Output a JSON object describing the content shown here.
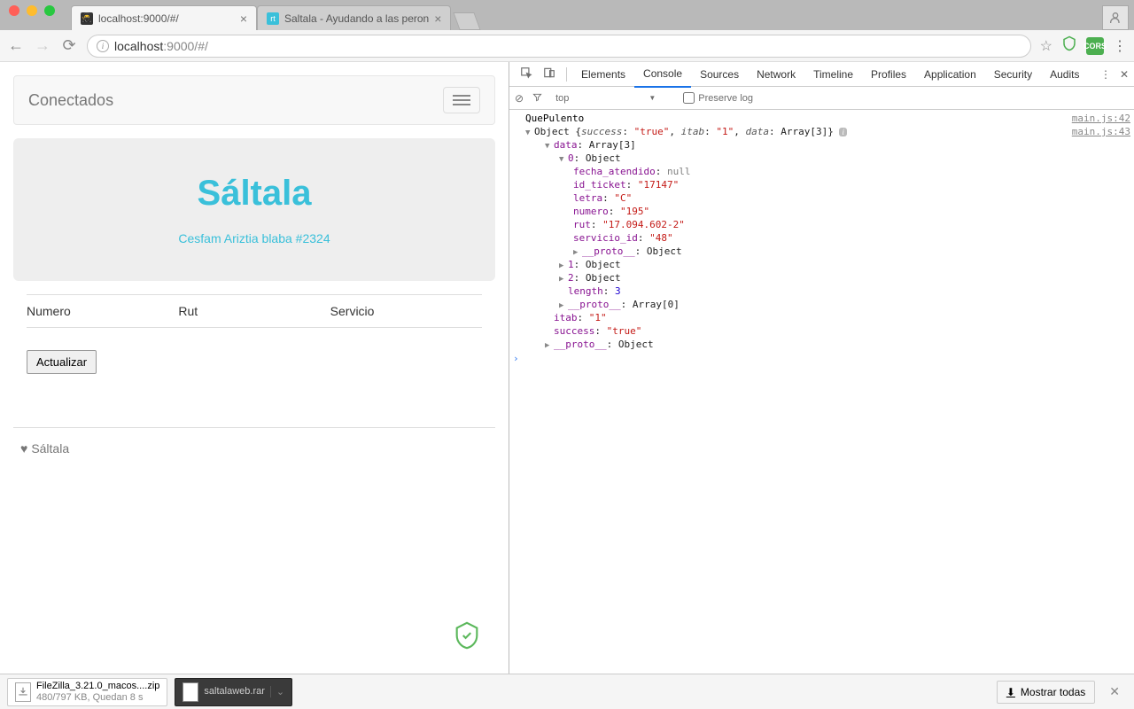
{
  "browser": {
    "tabs": [
      {
        "title": "localhost:9000/#/",
        "active": true
      },
      {
        "title": "Saltala - Ayudando a las peron",
        "active": false
      }
    ],
    "url_prefix": "localhost",
    "url_suffix": ":9000/#/"
  },
  "page": {
    "navbar_brand": "Conectados",
    "jumbo_title": "Sáltala",
    "jumbo_sub": "Cesfam Ariztia blaba #2324",
    "table_headers": [
      "Numero",
      "Rut",
      "Servicio"
    ],
    "button_label": "Actualizar",
    "footer_text": "Sáltala"
  },
  "devtools": {
    "tabs": [
      "Elements",
      "Console",
      "Sources",
      "Network",
      "Timeline",
      "Profiles",
      "Application",
      "Security",
      "Audits"
    ],
    "active_tab": "Console",
    "context": "top",
    "preserve_label": "Preserve log",
    "log1": "QuePulento",
    "src1": "main.js:42",
    "src2": "main.js:43",
    "obj_summary_prefix": "Object ",
    "obj_success_k": "success",
    "obj_success_v": "\"true\"",
    "obj_itab_k": "itab",
    "obj_itab_v": "\"1\"",
    "obj_data_k": "data",
    "obj_data_v": "Array[3]",
    "data_label": "data",
    "array3": "Array[3]",
    "idx0": "0",
    "obj_word": "Object",
    "f_fecha_k": "fecha_atendido",
    "f_fecha_v": "null",
    "f_id_k": "id_ticket",
    "f_id_v": "\"17147\"",
    "f_letra_k": "letra",
    "f_letra_v": "\"C\"",
    "f_numero_k": "numero",
    "f_numero_v": "\"195\"",
    "f_rut_k": "rut",
    "f_rut_v": "\"17.094.602-2\"",
    "f_serv_k": "servicio_id",
    "f_serv_v": "\"48\"",
    "proto_k": "__proto__",
    "idx1": "1",
    "idx2": "2",
    "length_k": "length",
    "length_v": "3",
    "array0": "Array[0]",
    "itab_k": "itab",
    "itab_v": "\"1\"",
    "success_k": "success",
    "success_v": "\"true\""
  },
  "downloads": {
    "item1_name": "FileZilla_3.21.0_macos....zip",
    "item1_sub": "480/797 KB, Quedan 8 s",
    "item2_name": "saltalaweb.rar",
    "show_all": "Mostrar todas"
  }
}
